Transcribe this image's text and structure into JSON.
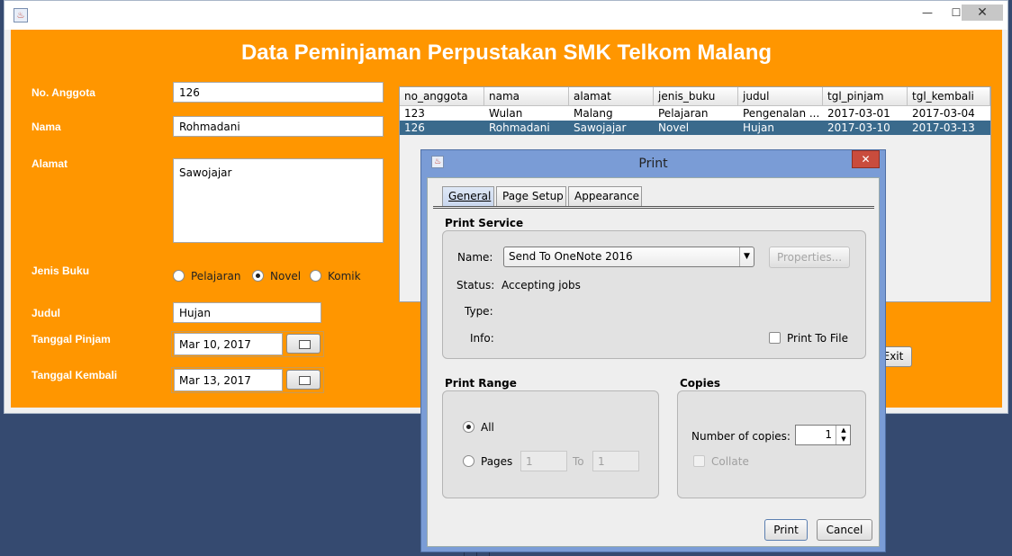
{
  "main": {
    "title": "Data Peminjaman Perpustakan SMK Telkom Malang",
    "window_buttons": {
      "minimize": "—",
      "maximize": "☐",
      "close": "✕"
    },
    "labels": {
      "no_anggota": "No. Anggota",
      "nama": "Nama",
      "alamat": "Alamat",
      "jenis_buku": "Jenis Buku",
      "judul": "Judul",
      "tanggal_pinjam": "Tanggal Pinjam",
      "tanggal_kembali": "Tanggal Kembali"
    },
    "values": {
      "no_anggota": "126",
      "nama": "Rohmadani",
      "alamat": "Sawojajar",
      "judul": "Hujan",
      "tanggal_pinjam": "Mar 10, 2017",
      "tanggal_kembali": "Mar 13, 2017"
    },
    "jenis_options": [
      "Pelajaran",
      "Novel",
      "Komik"
    ],
    "jenis_selected": "Novel",
    "exit_label": "Exit"
  },
  "table": {
    "headers": [
      "no_anggota",
      "nama",
      "alamat",
      "jenis_buku",
      "judul",
      "tgl_pinjam",
      "tgl_kembali"
    ],
    "rows": [
      [
        "123",
        "Wulan",
        "Malang",
        "Pelajaran",
        "Pengenalan ...",
        "2017-03-01",
        "2017-03-04"
      ],
      [
        "126",
        "Rohmadani",
        "Sawojajar",
        "Novel",
        "Hujan",
        "2017-03-10",
        "2017-03-13"
      ]
    ],
    "selected_row": 1
  },
  "print_dialog": {
    "title": "Print",
    "close_glyph": "✕",
    "tabs": [
      "General",
      "Page Setup",
      "Appearance"
    ],
    "active_tab": "General",
    "print_service": {
      "section": "Print Service",
      "name_label": "Name:",
      "name_value": "Send To OneNote 2016",
      "properties_label": "Properties...",
      "status_label": "Status:",
      "status_value": "Accepting jobs",
      "type_label": "Type:",
      "info_label": "Info:",
      "print_to_file_label": "Print To File"
    },
    "print_range": {
      "section": "Print Range",
      "all_label": "All",
      "pages_label": "Pages",
      "from_value": "1",
      "to_label": "To",
      "to_value": "1"
    },
    "copies": {
      "section": "Copies",
      "number_label": "Number of copies:",
      "number_value": "1",
      "collate_label": "Collate"
    },
    "print_button": "Print",
    "cancel_button": "Cancel"
  }
}
